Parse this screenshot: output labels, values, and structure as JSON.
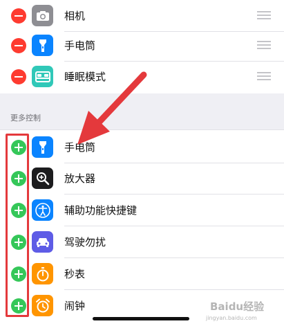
{
  "included_controls": [
    {
      "label": "相机",
      "icon": "camera-icon",
      "icon_color": "#8e8e93"
    },
    {
      "label": "手电筒",
      "icon": "flashlight-icon",
      "icon_color": "#0a84ff"
    },
    {
      "label": "睡眠模式",
      "icon": "bed-icon",
      "icon_color": "#30c8b8"
    }
  ],
  "more_controls_header": "更多控制",
  "more_controls": [
    {
      "label": "手电筒",
      "icon": "flashlight-icon",
      "icon_color": "#0a84ff"
    },
    {
      "label": "放大器",
      "icon": "magnifier-icon",
      "icon_color": "#1c1c1e"
    },
    {
      "label": "辅助功能快捷键",
      "icon": "accessibility-icon",
      "icon_color": "#0a84ff"
    },
    {
      "label": "驾驶勿扰",
      "icon": "car-icon",
      "icon_color": "#5e5ce6"
    },
    {
      "label": "秒表",
      "icon": "stopwatch-icon",
      "icon_color": "#ff9500"
    },
    {
      "label": "闹钟",
      "icon": "alarm-icon",
      "icon_color": "#ff9500"
    }
  ],
  "watermark": {
    "text": "Baidu经验",
    "sub": "jingyan.baidu.com"
  },
  "colors": {
    "remove": "#fe3b30",
    "add": "#35c759",
    "annotation": "#e4393c"
  }
}
